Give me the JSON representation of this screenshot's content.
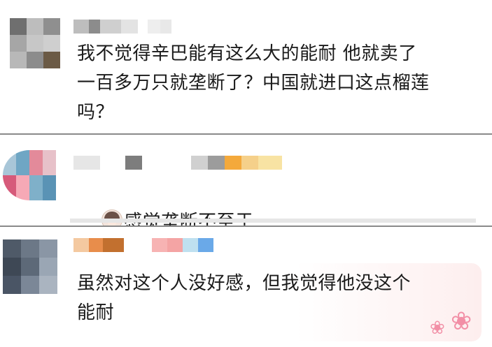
{
  "comments": [
    {
      "text": "我不觉得辛巴能有这么大的能耐 他就卖了\n一百多万只就垄断了？中国就进口这点榴莲\n吗？",
      "avatar_colors": [
        "#6f6f6f",
        "#bdbdbd",
        "#8f8f8f",
        "#a6a6a6",
        "#c7c7c7",
        "#cfcfcf",
        "#b8b8b8",
        "#8c8c8c",
        "#6b5a45",
        "#d9d9d9",
        "#c0c0c0",
        "#e0e0e0"
      ],
      "name_colors": [
        "#bdbdbd",
        "#8c8c8c",
        "#cfcfcf",
        "#e3e3e3",
        "#ffffff",
        "#eeeeee",
        "#e8e8e8"
      ]
    },
    {
      "text": "感觉垄断不至于",
      "avatar_colors": [
        "#a8c6d8",
        "#6fa6c4",
        "#e38a9a",
        "#e7c1c9",
        "#d65a7a",
        "#f6a9b6",
        "#7fb0c9",
        "#5a93b5"
      ],
      "name_colors": [
        "#e6e6e6",
        "#ffffff",
        "#7d7d7d",
        "#ffffff",
        "#ffffff",
        "#d0d0d0",
        "#9c9c9c",
        "#f4a93b",
        "#f5d08a",
        "#f8e3a3"
      ]
    },
    {
      "text": "虽然对这个人没好感，但我觉得他没这个\n能耐",
      "avatar_colors": [
        "#4f5a68",
        "#6c7887",
        "#8a96a5",
        "#3e4855",
        "#5d6978",
        "#9aa6b4",
        "#4a5565",
        "#7b8797",
        "#aab4c0"
      ],
      "name_colors": [
        "#f4c9a0",
        "#e88d4b",
        "#c2702f",
        "#ffffff",
        "#f7b3b3",
        "#f4a4a4",
        "#bfe0f0",
        "#6aa9e8"
      ]
    }
  ],
  "decorations": {
    "flower_icon": "❀"
  }
}
